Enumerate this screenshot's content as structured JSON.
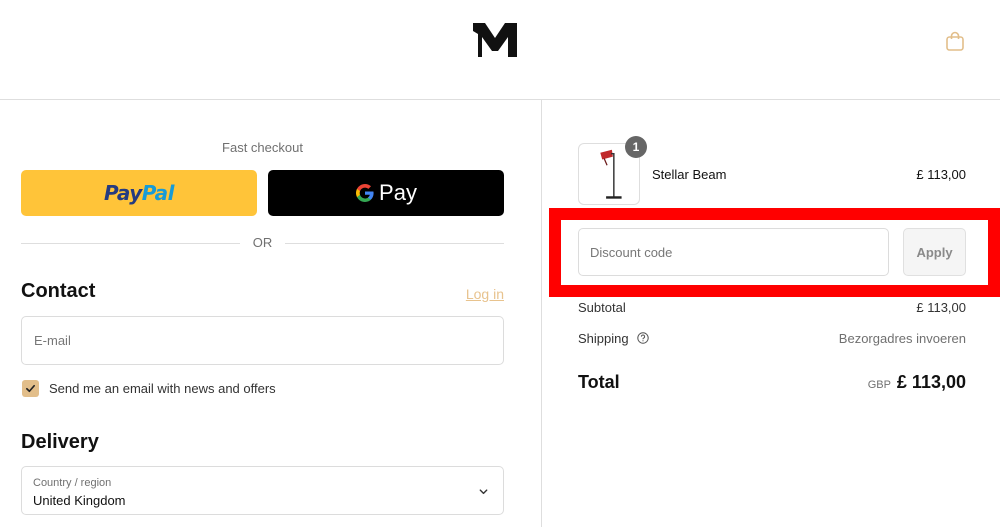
{
  "header": {
    "logo_icon": "m-monogram-logo",
    "cart_icon": "shopping-bag-icon"
  },
  "checkout": {
    "fast_checkout_label": "Fast checkout",
    "paypal": {
      "part1": "Pay",
      "part2": "Pal"
    },
    "gpay": {
      "label": "Pay",
      "icon": "google-g-icon"
    },
    "or_label": "OR"
  },
  "contact": {
    "title": "Contact",
    "login_link": "Log in",
    "email_placeholder": "E-mail",
    "newsletter_checked": true,
    "newsletter_label": "Send me an email with news and offers"
  },
  "delivery": {
    "title": "Delivery",
    "country_label": "Country / region",
    "country_value": "United Kingdom"
  },
  "summary": {
    "product": {
      "name": "Stellar Beam",
      "price": "£ 113,00",
      "quantity": "1"
    },
    "discount": {
      "placeholder": "Discount code",
      "apply_label": "Apply"
    },
    "subtotal": {
      "label": "Subtotal",
      "value": "£ 113,00"
    },
    "shipping": {
      "label": "Shipping",
      "value": "Bezorgadres invoeren"
    },
    "total": {
      "label": "Total",
      "currency": "GBP",
      "value": "£ 113,00"
    }
  },
  "colors": {
    "accent": "#e2be8a",
    "paypal_yellow": "#ffc439",
    "highlight": "#ff0000"
  }
}
